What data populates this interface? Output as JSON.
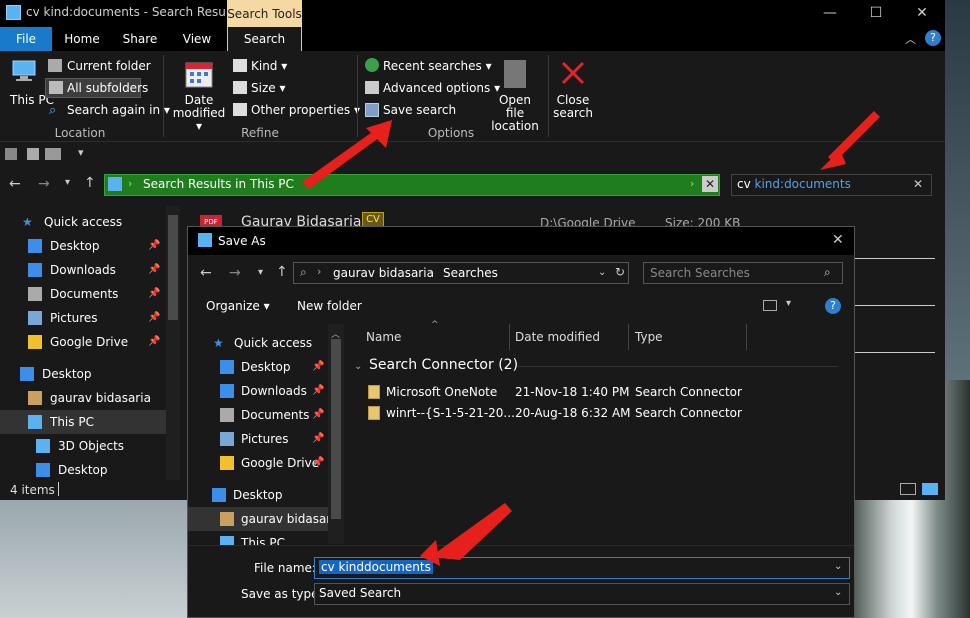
{
  "window": {
    "title": "cv kind:documents - Search Results in This PC",
    "context_tab": "Search Tools",
    "controls": {
      "minimize": "—",
      "maximize": "☐",
      "close": "✕"
    }
  },
  "tabs": [
    "File",
    "Home",
    "Share",
    "View",
    "Search"
  ],
  "ribbon": {
    "location": {
      "this_pc": "This PC",
      "current_folder": "Current folder",
      "all_subfolders": "All subfolders",
      "search_again_in": "Search again in",
      "label": "Location"
    },
    "refine": {
      "date_modified": "Date modified",
      "kind": "Kind",
      "size": "Size",
      "other_properties": "Other properties",
      "label": "Refine"
    },
    "options": {
      "recent_searches": "Recent searches",
      "advanced_options": "Advanced options",
      "save_search": "Save search",
      "open_file_location": "Open file location",
      "close_search": "Close search",
      "label": "Options"
    }
  },
  "address": {
    "breadcrumb": "Search Results in This PC",
    "search_query": "cv kind:documents",
    "search_query_prefix": "cv ",
    "search_query_kind": "kind:documents"
  },
  "nav": {
    "items": [
      {
        "label": "Quick access",
        "icon": "star-icon"
      },
      {
        "label": "Desktop",
        "icon": "desktop-icon",
        "pinned": true
      },
      {
        "label": "Downloads",
        "icon": "download-icon",
        "pinned": true
      },
      {
        "label": "Documents",
        "icon": "documents-icon",
        "pinned": true
      },
      {
        "label": "Pictures",
        "icon": "pictures-icon",
        "pinned": true
      },
      {
        "label": "Google Drive",
        "icon": "google-drive-icon",
        "pinned": true
      },
      {
        "label": "Desktop",
        "icon": "desktop-icon"
      },
      {
        "label": "gaurav bidasaria",
        "icon": "user-icon"
      },
      {
        "label": "This PC",
        "icon": "pc-icon"
      },
      {
        "label": "3D Objects",
        "icon": "cube-icon"
      },
      {
        "label": "Desktop",
        "icon": "desktop-icon"
      }
    ]
  },
  "result_peek": {
    "name": "Gaurav Bidasaria",
    "badge": "CV",
    "path": "D:\\Google Drive",
    "size": "Size: 200 KB"
  },
  "status": {
    "items": "4 items"
  },
  "dialog": {
    "title": "Save As",
    "path": [
      "gaurav bidasaria",
      "Searches"
    ],
    "search_placeholder": "Search Searches",
    "organize": "Organize",
    "new_folder": "New folder",
    "help": "?",
    "nav": [
      {
        "label": "Quick access",
        "icon": "star-icon"
      },
      {
        "label": "Desktop",
        "icon": "desktop-icon"
      },
      {
        "label": "Downloads",
        "icon": "download-icon"
      },
      {
        "label": "Documents",
        "icon": "documents-icon"
      },
      {
        "label": "Pictures",
        "icon": "pictures-icon"
      },
      {
        "label": "Google Drive",
        "icon": "google-drive-icon"
      },
      {
        "label": "Desktop",
        "icon": "desktop-icon"
      },
      {
        "label": "gaurav bidasaria",
        "icon": "user-icon"
      },
      {
        "label": "This PC",
        "icon": "pc-icon"
      }
    ],
    "columns": [
      "Name",
      "Date modified",
      "Type"
    ],
    "group": "Search Connector (2)",
    "rows": [
      {
        "name": "Microsoft OneNote",
        "date": "21-Nov-18 1:40 PM",
        "type": "Search Connector"
      },
      {
        "name": "winrt--{S-1-5-21-20...",
        "date": "20-Aug-18 6:32 AM",
        "type": "Search Connector"
      }
    ],
    "file_name_label": "File name:",
    "file_name": "cv kinddocuments",
    "save_as_type_label": "Save as type:",
    "save_as_type": "Saved Search"
  },
  "colors": {
    "accent": "#1979ca",
    "address_green": "#1f7d1d",
    "context_tab": "#f4d9a2",
    "annotation_red": "#e8201b"
  }
}
